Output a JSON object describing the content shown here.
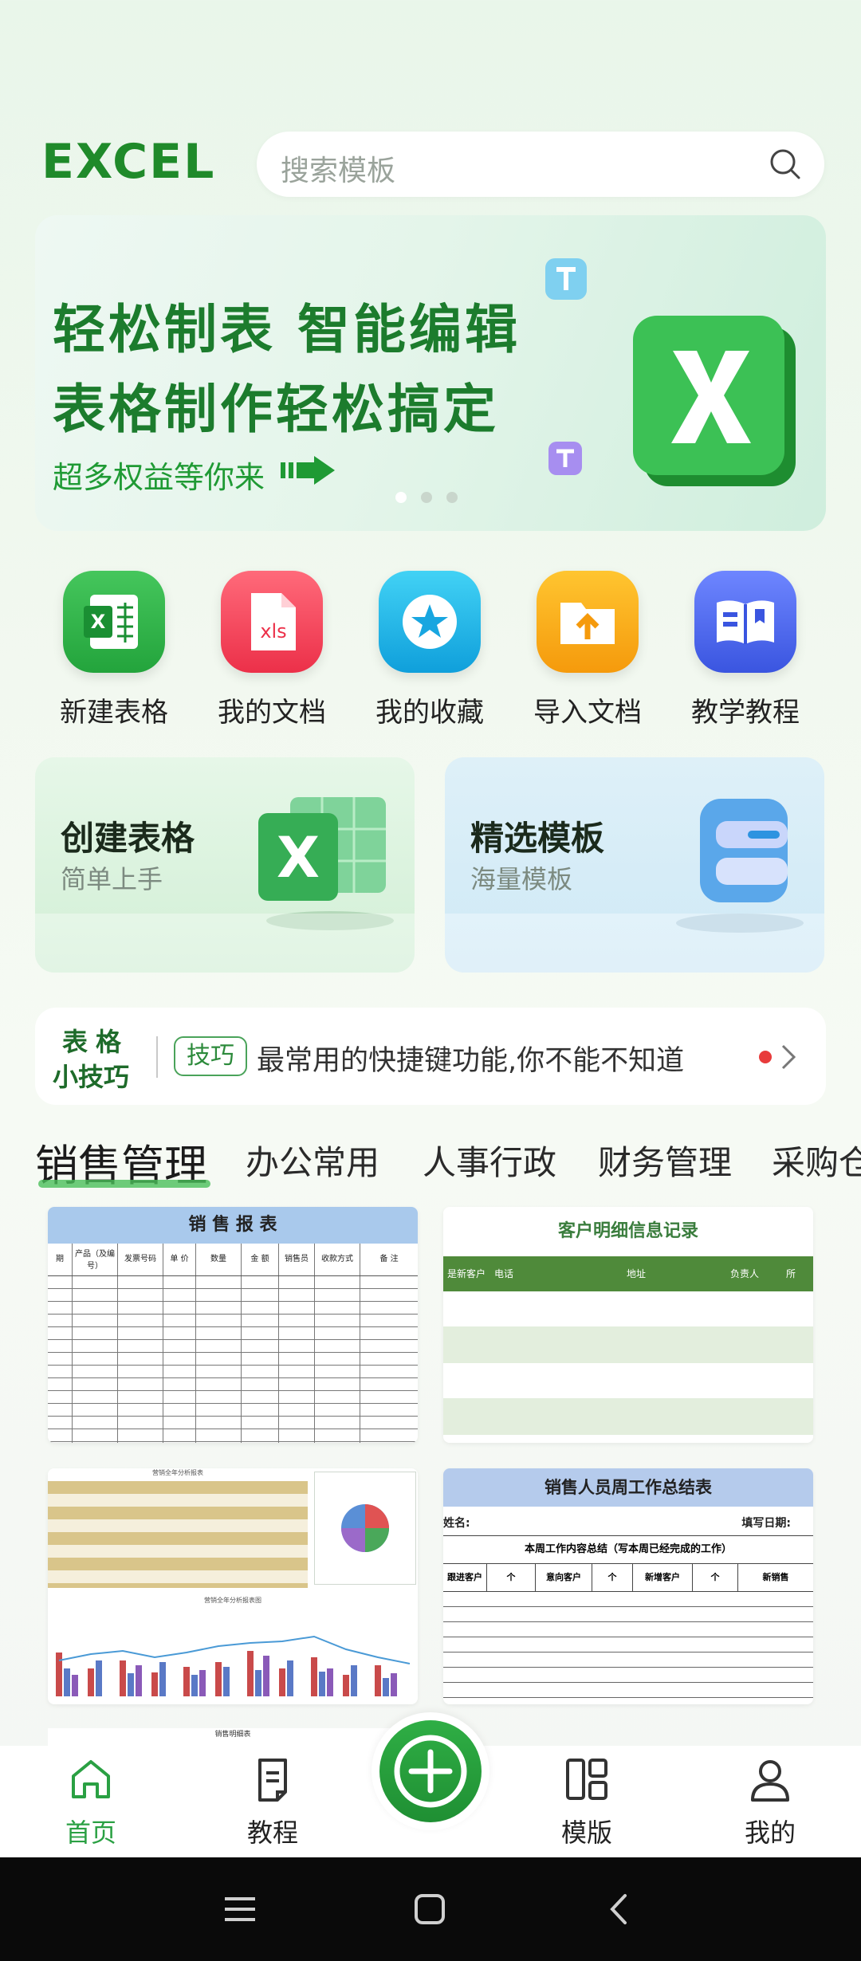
{
  "header": {
    "logo": "EXCEL",
    "search_placeholder": "搜索模板"
  },
  "banner": {
    "line1": "轻松制表 智能编辑",
    "line2": "表格制作轻松搞定",
    "line3": "超多权益等你来",
    "page_count": 3,
    "active_page": 1
  },
  "quick_actions": [
    {
      "label": "新建表格",
      "icon": "excel-doc-icon",
      "color": "#2fb14a"
    },
    {
      "label": "我的文档",
      "icon": "xls-file-icon",
      "color": "#f0465a"
    },
    {
      "label": "我的收藏",
      "icon": "star-icon",
      "color": "#18b4e6"
    },
    {
      "label": "导入文档",
      "icon": "import-folder-icon",
      "color": "#f7a614"
    },
    {
      "label": "教学教程",
      "icon": "book-icon",
      "color": "#4a67ea"
    }
  ],
  "cards": [
    {
      "title": "创建表格",
      "subtitle": "简单上手"
    },
    {
      "title": "精选模板",
      "subtitle": "海量模板"
    }
  ],
  "tips": {
    "brand_top": "表格",
    "brand_bottom": "小技巧",
    "tag": "技巧",
    "text": "最常用的快捷键功能,你不能不知道"
  },
  "categories": [
    "销售管理",
    "办公常用",
    "人事行政",
    "财务管理",
    "采购仓"
  ],
  "templates": {
    "sales_report": {
      "title": "销 售 报 表",
      "headers": [
        "期",
        "产品（及编号）",
        "发票号码",
        "单 价",
        "数量",
        "金 额",
        "销售员",
        "收款方式",
        "备 注"
      ]
    },
    "customer_detail": {
      "title": "客户明细信息记录",
      "headers": [
        "是新客户",
        "电话",
        "地址",
        "负责人",
        "所"
      ]
    },
    "sales_analysis": {
      "title": "营销全年分析报表",
      "chart_title": "营销全年分析报表图",
      "table_title": "销售明细表"
    },
    "weekly_summary": {
      "title": "销售人员周工作总结表",
      "name_label": "姓名:",
      "date_label": "填写日期:",
      "section": "本周工作内容总结（写本周已经完成的工作）",
      "headers": [
        "跟进客户",
        "个",
        "意向客户",
        "个",
        "新增客户",
        "个",
        "新销售"
      ]
    }
  },
  "bottom_nav": [
    {
      "label": "首页",
      "active": true
    },
    {
      "label": "教程",
      "active": false
    },
    {
      "label": "模版",
      "active": false
    },
    {
      "label": "我的",
      "active": false
    }
  ],
  "colors": {
    "brand_green": "#1f8a2a",
    "accent_green": "#2fae45"
  }
}
